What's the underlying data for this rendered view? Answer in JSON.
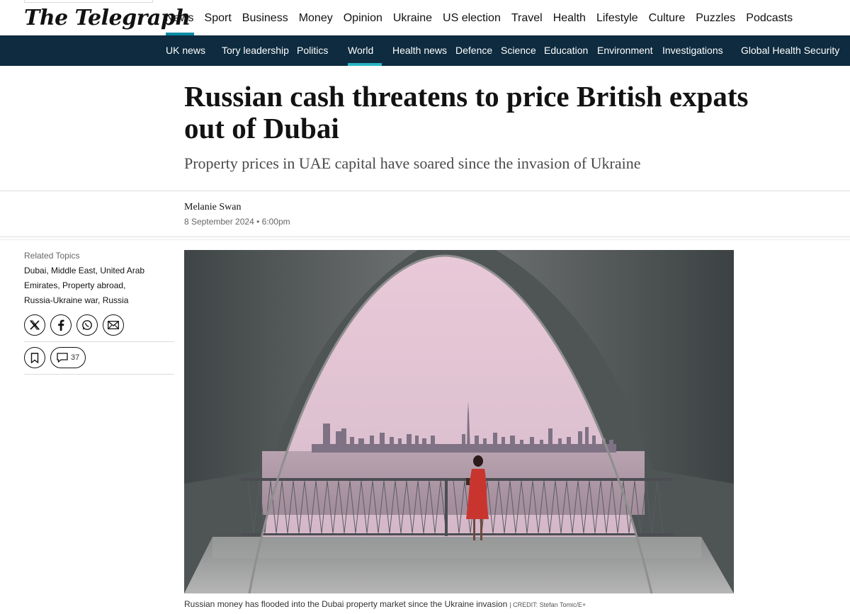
{
  "masthead": {
    "logo": "The Telegraph",
    "primary_nav": [
      {
        "label": "News",
        "active": true
      },
      {
        "label": "Sport"
      },
      {
        "label": "Business"
      },
      {
        "label": "Money"
      },
      {
        "label": "Opinion"
      },
      {
        "label": "Ukraine"
      },
      {
        "label": "US election"
      },
      {
        "label": "Travel"
      },
      {
        "label": "Health"
      },
      {
        "label": "Lifestyle"
      },
      {
        "label": "Culture"
      },
      {
        "label": "Puzzles"
      },
      {
        "label": "Podcasts"
      }
    ]
  },
  "secondary_nav": [
    {
      "label": "UK news"
    },
    {
      "label": "Tory leadership"
    },
    {
      "label": "Politics"
    },
    {
      "label": "World",
      "active": true
    },
    {
      "label": "Health news"
    },
    {
      "label": "Defence"
    },
    {
      "label": "Science"
    },
    {
      "label": "Education"
    },
    {
      "label": "Environment"
    },
    {
      "label": "Investigations"
    },
    {
      "label": "Global Health Security"
    }
  ],
  "article": {
    "headline": "Russian cash threatens to price British expats out of Dubai",
    "standfirst": "Property prices in UAE capital have soared since the invasion of Ukraine",
    "author": "Melanie Swan",
    "date": "8 September 2024 • 6:00pm",
    "caption": "Russian money has flooded into the Dubai property market since the Ukraine invasion",
    "credit": "| CREDIT: Stefan Tomic/E+"
  },
  "sidebar": {
    "related_title": "Related Topics",
    "related_topics": "Dubai, Middle East, United Arab Emirates, Property abroad, Russia-Ukraine war, Russia",
    "share_icons": [
      "x-icon",
      "facebook-icon",
      "whatsapp-icon",
      "email-icon"
    ],
    "comment_count": "37"
  },
  "colors": {
    "accent": "#0a8ca5",
    "secondary_nav_bg": "#0e2b3f",
    "active_underline": "#29b4c4"
  }
}
